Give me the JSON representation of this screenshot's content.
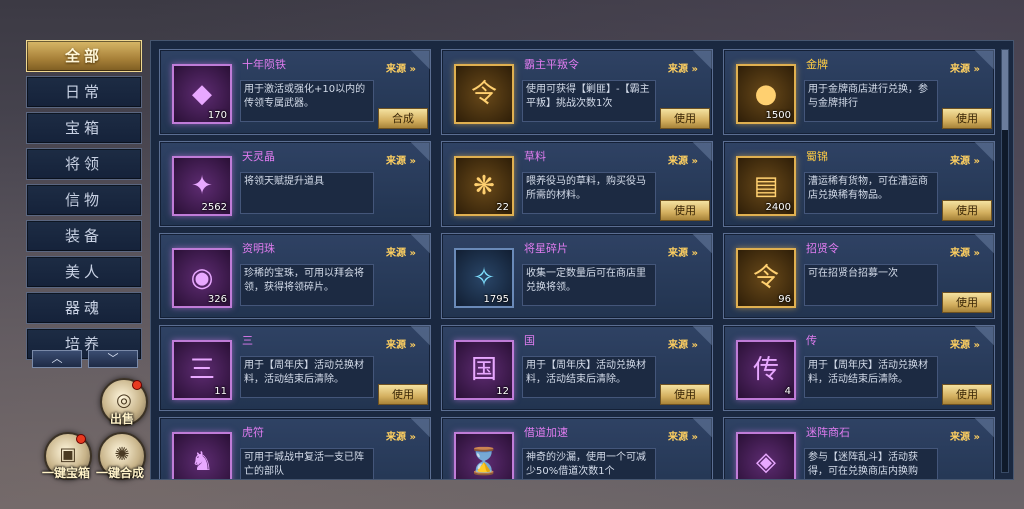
{
  "sidebar": {
    "tabs": [
      "全部",
      "日常",
      "宝箱",
      "将领",
      "信物",
      "装备",
      "美人",
      "器魂",
      "培养"
    ],
    "active_index": 0,
    "scroll_up": "︿",
    "scroll_down": "﹀"
  },
  "actions": {
    "sell": "出售",
    "one_key_box": "一键宝箱",
    "one_key_combine": "一键合成"
  },
  "source_label": "来源 »",
  "colors": {
    "purple_name": "#e07cf0",
    "gold_name": "#ffcc44",
    "accent": "#d4b060"
  },
  "items": [
    {
      "name": "十年陨铁",
      "qty": "170",
      "desc": "用于激活或强化+10以内的传领专属武器。",
      "button": "合成",
      "icon": "crystal-icon",
      "glyph": "◆",
      "frame": "purple",
      "name_color": "#e07cf0"
    },
    {
      "name": "霸主平叛令",
      "qty": "",
      "desc": "使用可获得【剿匪】-【霸主平叛】挑战次数1次",
      "button": "使用",
      "icon": "token-icon",
      "glyph": "令",
      "frame": "gold",
      "name_color": "#e07cf0"
    },
    {
      "name": "金牌",
      "qty": "1500",
      "desc": "用于金牌商店进行兑换，参与金牌排行",
      "button": "使用",
      "icon": "gold-medal-icon",
      "glyph": "●",
      "frame": "gold",
      "name_color": "#ffcc44"
    },
    {
      "name": "天灵晶",
      "qty": "2562",
      "desc": "将领天赋提升道具",
      "button": "",
      "icon": "crystal-icon",
      "glyph": "✦",
      "frame": "purple",
      "name_color": "#e07cf0"
    },
    {
      "name": "草料",
      "qty": "22",
      "desc": "喂养役马的草料，购买役马所需的材料。",
      "button": "使用",
      "icon": "hay-icon",
      "glyph": "❋",
      "frame": "gold",
      "name_color": "#e07cf0"
    },
    {
      "name": "蜀锦",
      "qty": "2400",
      "desc": "漕运稀有货物，可在漕运商店兑换稀有物品。",
      "button": "使用",
      "icon": "silk-icon",
      "glyph": "▤",
      "frame": "gold",
      "name_color": "#ffcc44"
    },
    {
      "name": "资明珠",
      "qty": "326",
      "desc": "珍稀的宝珠，可用以拜会将领，获得将领碎片。",
      "button": "",
      "icon": "pearl-icon",
      "glyph": "◉",
      "frame": "purple",
      "name_color": "#e07cf0"
    },
    {
      "name": "将星碎片",
      "qty": "1795",
      "desc": "收集一定数量后可在商店里兑换将领。",
      "button": "",
      "icon": "shard-icon",
      "glyph": "✧",
      "frame": "blue",
      "name_color": "#e07cf0"
    },
    {
      "name": "招贤令",
      "qty": "96",
      "desc": "可在招贤台招募一次",
      "button": "使用",
      "icon": "jade-token-icon",
      "glyph": "令",
      "frame": "gold",
      "name_color": "#e07cf0"
    },
    {
      "name": "三",
      "qty": "11",
      "desc": "用于【周年庆】活动兑换材料，活动结束后清除。",
      "button": "使用",
      "icon": "char-san-icon",
      "glyph": "三",
      "frame": "purple",
      "name_color": "#e07cf0"
    },
    {
      "name": "国",
      "qty": "12",
      "desc": "用于【周年庆】活动兑换材料，活动结束后清除。",
      "button": "使用",
      "icon": "char-guo-icon",
      "glyph": "国",
      "frame": "purple",
      "name_color": "#e07cf0"
    },
    {
      "name": "传",
      "qty": "4",
      "desc": "用于【周年庆】活动兑换材料，活动结束后清除。",
      "button": "使用",
      "icon": "char-chuan-icon",
      "glyph": "传",
      "frame": "purple",
      "name_color": "#e07cf0"
    },
    {
      "name": "虎符",
      "qty": "",
      "desc": "可用于城战中复活一支已阵亡的部队",
      "button": "",
      "icon": "tiger-tally-icon",
      "glyph": "♞",
      "frame": "purple",
      "name_color": "#e07cf0"
    },
    {
      "name": "借道加速",
      "qty": "",
      "desc": "神奇的沙漏，使用一个可减少50%借道次数1个",
      "button": "",
      "icon": "hourglass-icon",
      "glyph": "⌛",
      "frame": "purple",
      "name_color": "#e07cf0"
    },
    {
      "name": "迷阵商石",
      "qty": "",
      "desc": "参与【迷阵乱斗】活动获得，可在兑换商店内换购",
      "button": "",
      "icon": "stone-icon",
      "glyph": "◈",
      "frame": "purple",
      "name_color": "#e07cf0"
    }
  ]
}
